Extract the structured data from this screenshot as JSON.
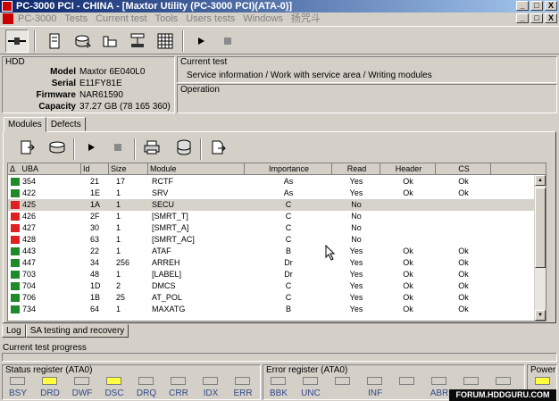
{
  "window": {
    "title": "PC-3000 PCI - CHINA - [Maxtor Utility (PC-3000 PCI)(ATA-0)]",
    "controls": [
      "_",
      "□",
      "X"
    ]
  },
  "menu": {
    "items": [
      "PC-3000",
      "Tests",
      "Current test",
      "Tools",
      "Users tests",
      "Windows",
      "扬咒斗"
    ],
    "controls": [
      "_",
      "□",
      "X"
    ]
  },
  "hdd": {
    "label": "HDD",
    "fields": [
      {
        "key": "Model",
        "value": "Maxtor 6E040L0"
      },
      {
        "key": "Serial",
        "value": "E11FY81E"
      },
      {
        "key": "Firmware",
        "value": "NAR61590"
      },
      {
        "key": "Capacity",
        "value": "37.27 GB (78 165 360)"
      }
    ]
  },
  "current_test": {
    "label": "Current test",
    "value": "Service information / Work with service area / Writing modules"
  },
  "operation": {
    "label": "Operation"
  },
  "top_tabs": [
    "Modules",
    "Defects"
  ],
  "table": {
    "headers": [
      "UBA",
      "Id",
      "Size",
      "Module",
      "Importance",
      "Read",
      "Header",
      "CS"
    ],
    "sort_glyph": "Δ",
    "rows": [
      {
        "status": "#1f8a2a",
        "uba": "354",
        "id": "21",
        "size": "17",
        "module": "RCTF",
        "importance": "As",
        "read": "Yes",
        "header": "Ok",
        "cs": "Ok"
      },
      {
        "status": "#1f8a2a",
        "uba": "422",
        "id": "1E",
        "size": "1",
        "module": "SRV",
        "importance": "As",
        "read": "Yes",
        "header": "Ok",
        "cs": "Ok"
      },
      {
        "status": "#e02020",
        "uba": "425",
        "id": "1A",
        "size": "1",
        "module": "SECU",
        "importance": "C",
        "read": "No",
        "header": "",
        "cs": ""
      },
      {
        "status": "#e02020",
        "uba": "426",
        "id": "2F",
        "size": "1",
        "module": "[SMRT_T]",
        "importance": "C",
        "read": "No",
        "header": "",
        "cs": ""
      },
      {
        "status": "#e02020",
        "uba": "427",
        "id": "30",
        "size": "1",
        "module": "[SMRT_A]",
        "importance": "C",
        "read": "No",
        "header": "",
        "cs": ""
      },
      {
        "status": "#e02020",
        "uba": "428",
        "id": "63",
        "size": "1",
        "module": "[SMRT_AC]",
        "importance": "C",
        "read": "No",
        "header": "",
        "cs": ""
      },
      {
        "status": "#1f8a2a",
        "uba": "443",
        "id": "22",
        "size": "1",
        "module": "ATAF",
        "importance": "B",
        "read": "Yes",
        "header": "Ok",
        "cs": "Ok"
      },
      {
        "status": "#1f8a2a",
        "uba": "447",
        "id": "34",
        "size": "256",
        "module": "ARREH",
        "importance": "Dr",
        "read": "Yes",
        "header": "Ok",
        "cs": "Ok"
      },
      {
        "status": "#1f8a2a",
        "uba": "703",
        "id": "48",
        "size": "1",
        "module": "[LABEL]",
        "importance": "Dr",
        "read": "Yes",
        "header": "Ok",
        "cs": "Ok"
      },
      {
        "status": "#1f8a2a",
        "uba": "704",
        "id": "1D",
        "size": "2",
        "module": "DMCS",
        "importance": "C",
        "read": "Yes",
        "header": "Ok",
        "cs": "Ok"
      },
      {
        "status": "#1f8a2a",
        "uba": "706",
        "id": "1B",
        "size": "25",
        "module": "AT_POL",
        "importance": "C",
        "read": "Yes",
        "header": "Ok",
        "cs": "Ok"
      },
      {
        "status": "#1f8a2a",
        "uba": "734",
        "id": "64",
        "size": "1",
        "module": "MAXATG",
        "importance": "B",
        "read": "Yes",
        "header": "Ok",
        "cs": "Ok"
      }
    ]
  },
  "bottom_tabs": [
    "Log",
    "SA testing and recovery"
  ],
  "progress": {
    "label": "Current test progress",
    "value": 0
  },
  "status_register": {
    "title": "Status register (ATA0)",
    "leds": [
      {
        "label": "BSY",
        "on": false
      },
      {
        "label": "DRD",
        "on": true
      },
      {
        "label": "DWF",
        "on": false
      },
      {
        "label": "DSC",
        "on": true
      },
      {
        "label": "DRQ",
        "on": false
      },
      {
        "label": "CRR",
        "on": false
      },
      {
        "label": "IDX",
        "on": false
      },
      {
        "label": "ERR",
        "on": false
      }
    ]
  },
  "error_register": {
    "title": "Error register (ATA0)",
    "leds": [
      {
        "label": "BBK",
        "on": false
      },
      {
        "label": "UNC",
        "on": false
      },
      {
        "label": "",
        "on": false
      },
      {
        "label": "INF",
        "on": false
      },
      {
        "label": "",
        "on": false
      },
      {
        "label": "ABR",
        "on": false
      },
      {
        "label": "",
        "on": false
      },
      {
        "label": "",
        "on": false
      }
    ]
  },
  "power": {
    "title": "Power",
    "on": true
  },
  "watermark": "FORUM.HDDGURU.COM",
  "colors": {
    "led_on": "#ffff40",
    "ok_status": "#1f8a2a",
    "bad_status": "#e02020",
    "title_start": "#0a246a"
  }
}
